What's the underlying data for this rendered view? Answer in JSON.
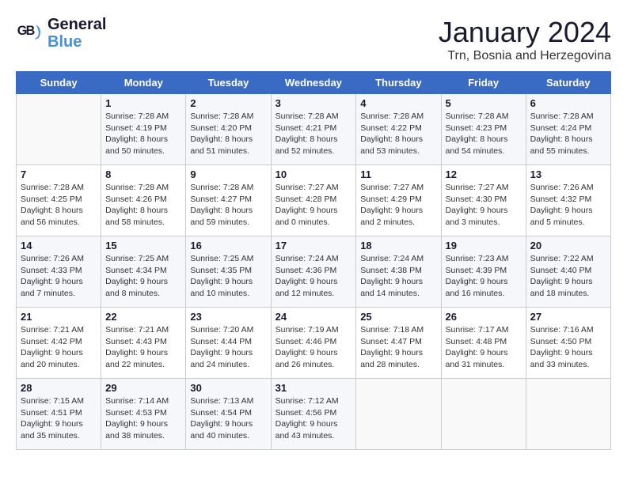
{
  "header": {
    "logo_line1": "General",
    "logo_line2": "Blue",
    "title": "January 2024",
    "subtitle": "Trn, Bosnia and Herzegovina"
  },
  "days_of_week": [
    "Sunday",
    "Monday",
    "Tuesday",
    "Wednesday",
    "Thursday",
    "Friday",
    "Saturday"
  ],
  "weeks": [
    [
      {
        "day": "",
        "sunrise": "",
        "sunset": "",
        "daylight": ""
      },
      {
        "day": "1",
        "sunrise": "Sunrise: 7:28 AM",
        "sunset": "Sunset: 4:19 PM",
        "daylight": "Daylight: 8 hours and 50 minutes."
      },
      {
        "day": "2",
        "sunrise": "Sunrise: 7:28 AM",
        "sunset": "Sunset: 4:20 PM",
        "daylight": "Daylight: 8 hours and 51 minutes."
      },
      {
        "day": "3",
        "sunrise": "Sunrise: 7:28 AM",
        "sunset": "Sunset: 4:21 PM",
        "daylight": "Daylight: 8 hours and 52 minutes."
      },
      {
        "day": "4",
        "sunrise": "Sunrise: 7:28 AM",
        "sunset": "Sunset: 4:22 PM",
        "daylight": "Daylight: 8 hours and 53 minutes."
      },
      {
        "day": "5",
        "sunrise": "Sunrise: 7:28 AM",
        "sunset": "Sunset: 4:23 PM",
        "daylight": "Daylight: 8 hours and 54 minutes."
      },
      {
        "day": "6",
        "sunrise": "Sunrise: 7:28 AM",
        "sunset": "Sunset: 4:24 PM",
        "daylight": "Daylight: 8 hours and 55 minutes."
      }
    ],
    [
      {
        "day": "7",
        "sunrise": "Sunrise: 7:28 AM",
        "sunset": "Sunset: 4:25 PM",
        "daylight": "Daylight: 8 hours and 56 minutes."
      },
      {
        "day": "8",
        "sunrise": "Sunrise: 7:28 AM",
        "sunset": "Sunset: 4:26 PM",
        "daylight": "Daylight: 8 hours and 58 minutes."
      },
      {
        "day": "9",
        "sunrise": "Sunrise: 7:28 AM",
        "sunset": "Sunset: 4:27 PM",
        "daylight": "Daylight: 8 hours and 59 minutes."
      },
      {
        "day": "10",
        "sunrise": "Sunrise: 7:27 AM",
        "sunset": "Sunset: 4:28 PM",
        "daylight": "Daylight: 9 hours and 0 minutes."
      },
      {
        "day": "11",
        "sunrise": "Sunrise: 7:27 AM",
        "sunset": "Sunset: 4:29 PM",
        "daylight": "Daylight: 9 hours and 2 minutes."
      },
      {
        "day": "12",
        "sunrise": "Sunrise: 7:27 AM",
        "sunset": "Sunset: 4:30 PM",
        "daylight": "Daylight: 9 hours and 3 minutes."
      },
      {
        "day": "13",
        "sunrise": "Sunrise: 7:26 AM",
        "sunset": "Sunset: 4:32 PM",
        "daylight": "Daylight: 9 hours and 5 minutes."
      }
    ],
    [
      {
        "day": "14",
        "sunrise": "Sunrise: 7:26 AM",
        "sunset": "Sunset: 4:33 PM",
        "daylight": "Daylight: 9 hours and 7 minutes."
      },
      {
        "day": "15",
        "sunrise": "Sunrise: 7:25 AM",
        "sunset": "Sunset: 4:34 PM",
        "daylight": "Daylight: 9 hours and 8 minutes."
      },
      {
        "day": "16",
        "sunrise": "Sunrise: 7:25 AM",
        "sunset": "Sunset: 4:35 PM",
        "daylight": "Daylight: 9 hours and 10 minutes."
      },
      {
        "day": "17",
        "sunrise": "Sunrise: 7:24 AM",
        "sunset": "Sunset: 4:36 PM",
        "daylight": "Daylight: 9 hours and 12 minutes."
      },
      {
        "day": "18",
        "sunrise": "Sunrise: 7:24 AM",
        "sunset": "Sunset: 4:38 PM",
        "daylight": "Daylight: 9 hours and 14 minutes."
      },
      {
        "day": "19",
        "sunrise": "Sunrise: 7:23 AM",
        "sunset": "Sunset: 4:39 PM",
        "daylight": "Daylight: 9 hours and 16 minutes."
      },
      {
        "day": "20",
        "sunrise": "Sunrise: 7:22 AM",
        "sunset": "Sunset: 4:40 PM",
        "daylight": "Daylight: 9 hours and 18 minutes."
      }
    ],
    [
      {
        "day": "21",
        "sunrise": "Sunrise: 7:21 AM",
        "sunset": "Sunset: 4:42 PM",
        "daylight": "Daylight: 9 hours and 20 minutes."
      },
      {
        "day": "22",
        "sunrise": "Sunrise: 7:21 AM",
        "sunset": "Sunset: 4:43 PM",
        "daylight": "Daylight: 9 hours and 22 minutes."
      },
      {
        "day": "23",
        "sunrise": "Sunrise: 7:20 AM",
        "sunset": "Sunset: 4:44 PM",
        "daylight": "Daylight: 9 hours and 24 minutes."
      },
      {
        "day": "24",
        "sunrise": "Sunrise: 7:19 AM",
        "sunset": "Sunset: 4:46 PM",
        "daylight": "Daylight: 9 hours and 26 minutes."
      },
      {
        "day": "25",
        "sunrise": "Sunrise: 7:18 AM",
        "sunset": "Sunset: 4:47 PM",
        "daylight": "Daylight: 9 hours and 28 minutes."
      },
      {
        "day": "26",
        "sunrise": "Sunrise: 7:17 AM",
        "sunset": "Sunset: 4:48 PM",
        "daylight": "Daylight: 9 hours and 31 minutes."
      },
      {
        "day": "27",
        "sunrise": "Sunrise: 7:16 AM",
        "sunset": "Sunset: 4:50 PM",
        "daylight": "Daylight: 9 hours and 33 minutes."
      }
    ],
    [
      {
        "day": "28",
        "sunrise": "Sunrise: 7:15 AM",
        "sunset": "Sunset: 4:51 PM",
        "daylight": "Daylight: 9 hours and 35 minutes."
      },
      {
        "day": "29",
        "sunrise": "Sunrise: 7:14 AM",
        "sunset": "Sunset: 4:53 PM",
        "daylight": "Daylight: 9 hours and 38 minutes."
      },
      {
        "day": "30",
        "sunrise": "Sunrise: 7:13 AM",
        "sunset": "Sunset: 4:54 PM",
        "daylight": "Daylight: 9 hours and 40 minutes."
      },
      {
        "day": "31",
        "sunrise": "Sunrise: 7:12 AM",
        "sunset": "Sunset: 4:56 PM",
        "daylight": "Daylight: 9 hours and 43 minutes."
      },
      {
        "day": "",
        "sunrise": "",
        "sunset": "",
        "daylight": ""
      },
      {
        "day": "",
        "sunrise": "",
        "sunset": "",
        "daylight": ""
      },
      {
        "day": "",
        "sunrise": "",
        "sunset": "",
        "daylight": ""
      }
    ]
  ]
}
